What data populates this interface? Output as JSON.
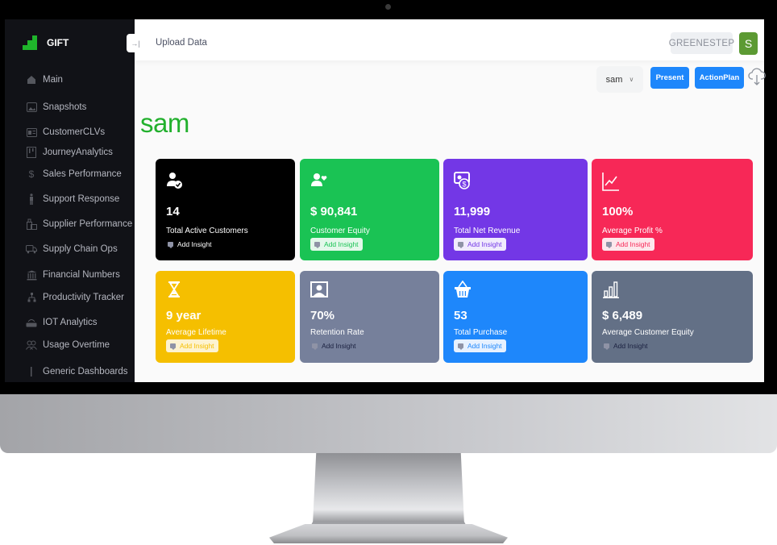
{
  "app": {
    "name": "GIFT",
    "brand_color": "#1fb52b"
  },
  "sidebar": {
    "items": [
      {
        "label": "Main",
        "icon": "home-icon"
      },
      {
        "label": "Snapshots",
        "icon": "image-icon"
      },
      {
        "label": "CustomerCLVs",
        "icon": "id-card-icon"
      },
      {
        "label": "JourneyAnalytics",
        "icon": "kanban-icon"
      },
      {
        "label": "Sales Performance",
        "icon": "dollar-icon"
      },
      {
        "label": "Support Response",
        "icon": "person-standing-icon"
      },
      {
        "label": "Supplier Performance",
        "icon": "luggage-icon"
      },
      {
        "label": "Supply Chain Ops",
        "icon": "truck-icon"
      },
      {
        "label": "Financial Numbers",
        "icon": "bank-icon"
      },
      {
        "label": "Productivity Tracker",
        "icon": "hierarchy-icon"
      },
      {
        "label": "IOT Analytics",
        "icon": "router-icon"
      },
      {
        "label": "Usage Overtime",
        "icon": "users-icon"
      },
      {
        "label": "Generic Dashboards",
        "icon": "bar-icon"
      }
    ]
  },
  "topbar": {
    "collapse_icon": "→|",
    "upload_label": "Upload Data",
    "org_name": "GREENESTEP",
    "avatar_initial": "S"
  },
  "toolbar": {
    "user_select": {
      "value": "sam",
      "chevron": "⌄"
    },
    "present_label": "Present",
    "actionplan_label": "ActionPlan",
    "download_icon": "cloud-download-icon"
  },
  "page": {
    "title": "sam"
  },
  "cards": [
    {
      "value": "14",
      "label": "Total Active Customers",
      "insight": "Add Insight",
      "color": "#000000",
      "icon": "user-check-icon",
      "insight_bg": "transparent",
      "insight_color": "#ffffff"
    },
    {
      "value": "$ 90,841",
      "label": "Customer Equity",
      "insight": "Add Insight",
      "color": "#1ac354",
      "icon": "user-heart-icon",
      "insight_bg": "#e3f8ea",
      "insight_color": "#1ac354"
    },
    {
      "value": "11,999",
      "label": "Total Net Revenue",
      "insight": "Add Insight",
      "color": "#7337e6",
      "icon": "money-icon",
      "insight_bg": "#f1ebfd",
      "insight_color": "#7337e6"
    },
    {
      "value": "100%",
      "label": "Average Profit %",
      "insight": "Add Insight",
      "color": "#f72857",
      "icon": "line-chart-icon",
      "insight_bg": "#fde7ec",
      "insight_color": "#f72857"
    },
    {
      "value": "9 year",
      "label": "Average Lifetime",
      "insight": "Add Insight",
      "color": "#f5bf00",
      "icon": "hourglass-icon",
      "insight_bg": "#fdf3d0",
      "insight_color": "#f5bf00"
    },
    {
      "value": "70%",
      "label": "Retention Rate",
      "insight": "Add Insight",
      "color": "#76809b",
      "icon": "portrait-icon",
      "insight_bg": "transparent",
      "insight_color": "#1b2140"
    },
    {
      "value": "53",
      "label": "Total Purchase",
      "insight": "Add Insight",
      "color": "#1e87fb",
      "icon": "basket-icon",
      "insight_bg": "#e6f1ff",
      "insight_color": "#1e87fb"
    },
    {
      "value": "$ 6,489",
      "label": "Average Customer Equity",
      "insight": "Add Insight",
      "color": "#637086",
      "icon": "bar-chart-icon",
      "insight_bg": "transparent",
      "insight_color": "#1b2140"
    }
  ]
}
